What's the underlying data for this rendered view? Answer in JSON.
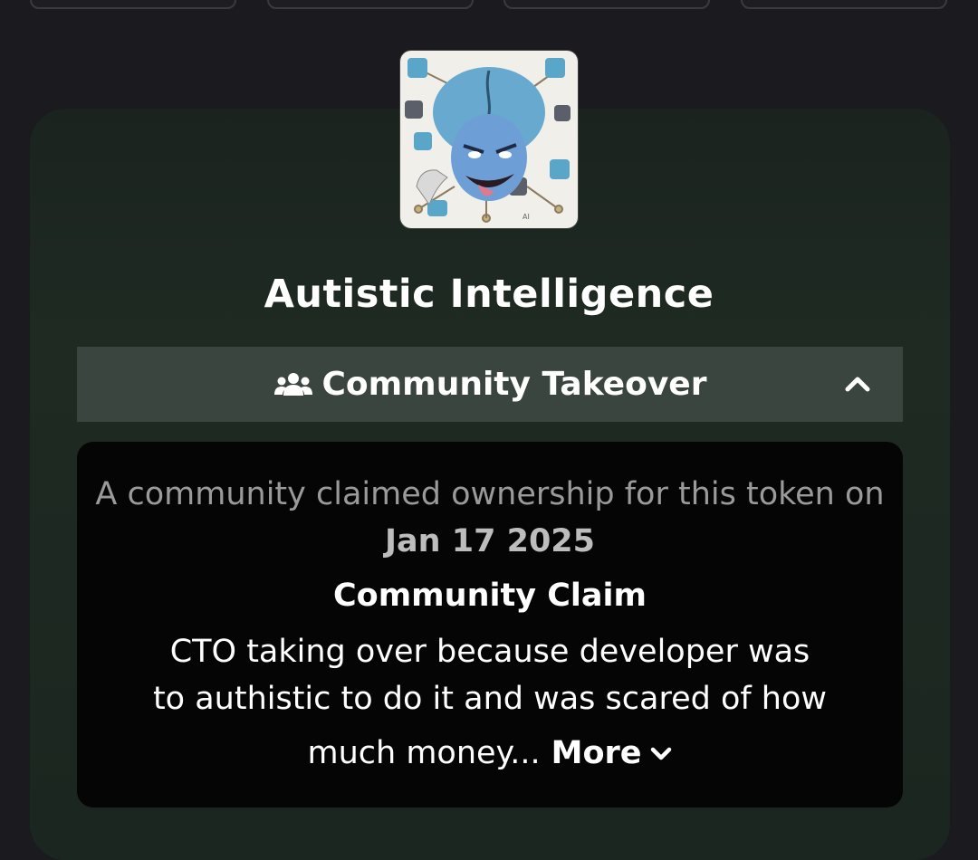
{
  "token": {
    "name": "Autistic Intelligence"
  },
  "cto": {
    "label": "Community Takeover",
    "desc_prefix": "A community claimed ownership for this token on",
    "date": "Jan 17 2025",
    "claim_title": "Community Claim",
    "claim_line1": "CTO taking over because developer was",
    "claim_line2": "to authistic to do it and was scared of how",
    "claim_line3": "much money...",
    "more_label": "More"
  },
  "icons": {
    "group": "users-icon",
    "collapse": "chevron-up-icon",
    "expand": "chevron-down-icon"
  },
  "colors": {
    "background": "#1b1b1f",
    "card": "#1f2a23",
    "bar": "#3b4540",
    "panel": "#050505",
    "text": "#ffffff",
    "muted": "#9a9a9a"
  }
}
